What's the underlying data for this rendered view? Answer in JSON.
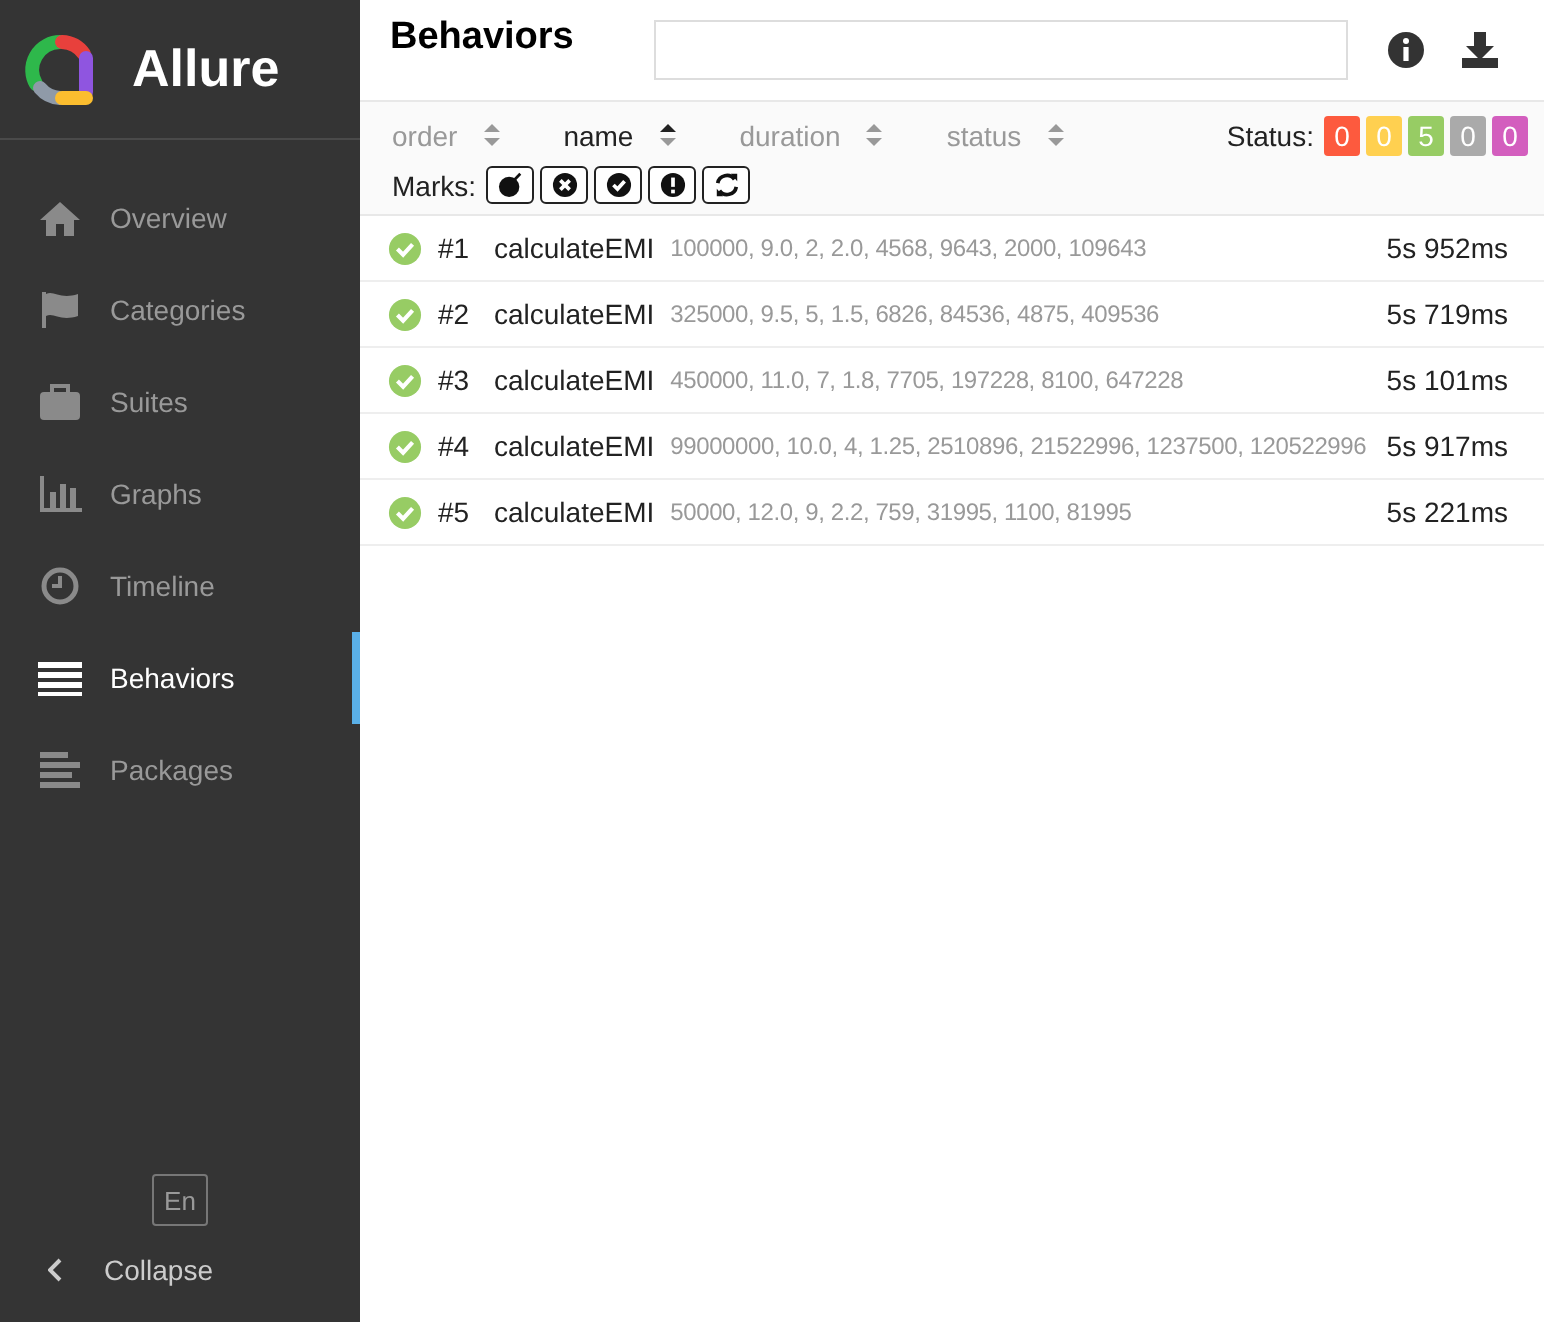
{
  "sidebar": {
    "brand": "Allure",
    "items": [
      {
        "label": "Overview",
        "selected": false
      },
      {
        "label": "Categories",
        "selected": false
      },
      {
        "label": "Suites",
        "selected": false
      },
      {
        "label": "Graphs",
        "selected": false
      },
      {
        "label": "Timeline",
        "selected": false
      },
      {
        "label": "Behaviors",
        "selected": true
      },
      {
        "label": "Packages",
        "selected": false
      }
    ],
    "language": "En",
    "collapse": "Collapse"
  },
  "header": {
    "title": "Behaviors"
  },
  "sorters": [
    {
      "label": "order",
      "selected": false
    },
    {
      "label": "name",
      "selected": true
    },
    {
      "label": "duration",
      "selected": false
    },
    {
      "label": "status",
      "selected": false
    }
  ],
  "status_filter": {
    "label": "Status:",
    "counts": [
      {
        "value": "0",
        "color": "#fd5a3e"
      },
      {
        "value": "0",
        "color": "#ffd050"
      },
      {
        "value": "5",
        "color": "#97cc64"
      },
      {
        "value": "0",
        "color": "#aaaaaa"
      },
      {
        "value": "0",
        "color": "#d35ebe"
      }
    ]
  },
  "marks": {
    "label": "Marks:"
  },
  "rows": [
    {
      "index": "#1",
      "name": "calculateEMI",
      "params": "100000, 9.0, 2, 2.0, 4568, 9643, 2000, 109643",
      "duration": "5s 952ms",
      "passed": true
    },
    {
      "index": "#2",
      "name": "calculateEMI",
      "params": "325000, 9.5, 5, 1.5, 6826, 84536, 4875, 409536",
      "duration": "5s 719ms",
      "passed": true
    },
    {
      "index": "#3",
      "name": "calculateEMI",
      "params": "450000, 11.0, 7, 1.8, 7705, 197228, 8100, 647228",
      "duration": "5s 101ms",
      "passed": true
    },
    {
      "index": "#4",
      "name": "calculateEMI",
      "params": "99000000, 10.0, 4, 1.25, 2510896, 21522996, 1237500, 120522996",
      "duration": "5s 917ms",
      "passed": true
    },
    {
      "index": "#5",
      "name": "calculateEMI",
      "params": "50000, 12.0, 9, 2.2, 759, 31995, 1100, 81995",
      "duration": "5s 221ms",
      "passed": true
    }
  ]
}
